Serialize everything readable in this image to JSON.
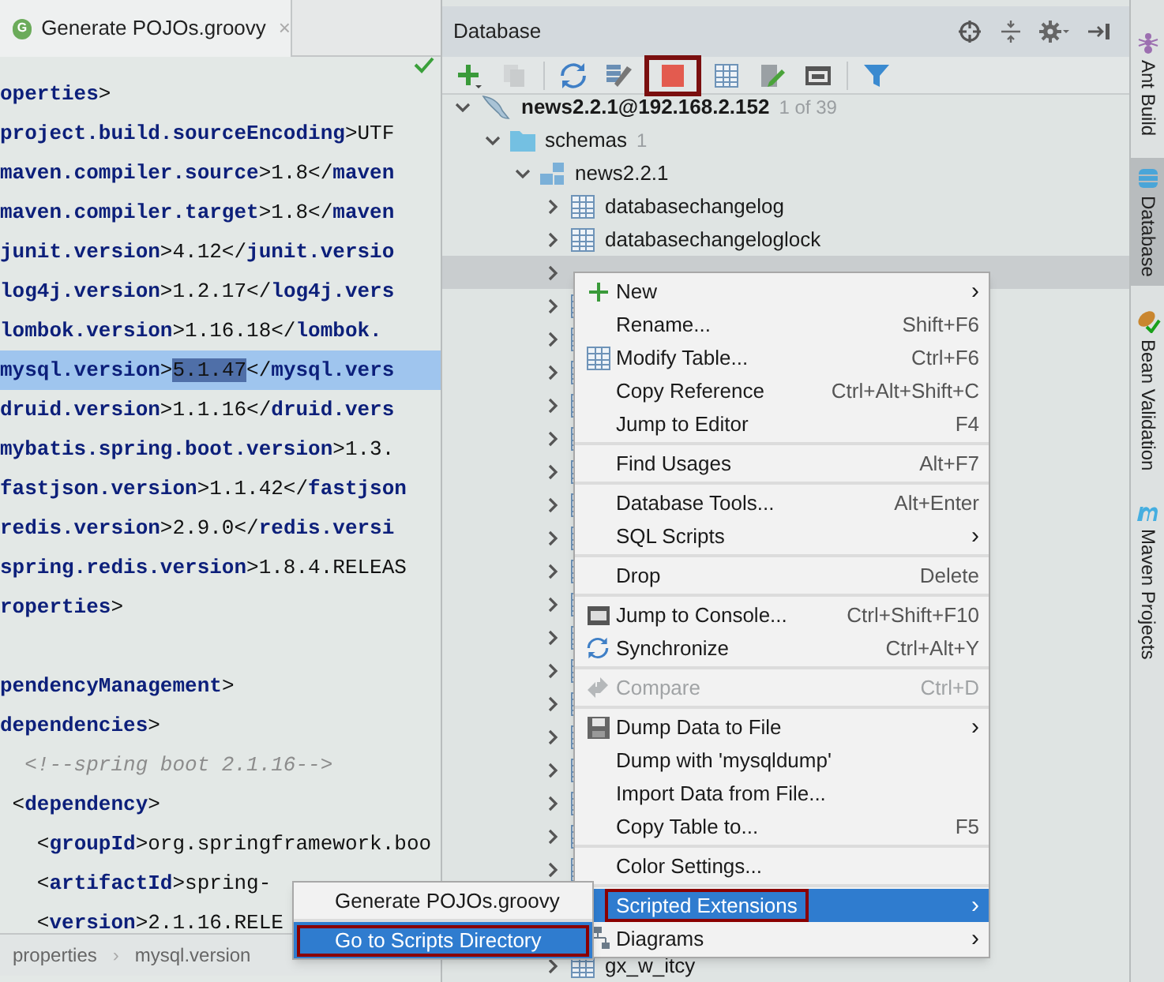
{
  "editor": {
    "tab": {
      "title": "Generate POJOs.groovy",
      "badge": "G",
      "close": "×",
      "selected": true
    },
    "lines": [
      {
        "selected": false,
        "segments": [
          {
            "kind": "tag",
            "text": "operties"
          },
          {
            "kind": "value",
            "text": ">"
          }
        ]
      },
      {
        "selected": false,
        "segments": [
          {
            "kind": "tag",
            "text": "project.build.sourceEncoding"
          },
          {
            "kind": "value",
            "text": ">UTF"
          }
        ]
      },
      {
        "selected": false,
        "segments": [
          {
            "kind": "tag",
            "text": "maven.compiler.source"
          },
          {
            "kind": "value",
            "text": ">1.8</"
          },
          {
            "kind": "tag",
            "text": "maven"
          }
        ]
      },
      {
        "selected": false,
        "segments": [
          {
            "kind": "tag",
            "text": "maven.compiler.target"
          },
          {
            "kind": "value",
            "text": ">1.8</"
          },
          {
            "kind": "tag",
            "text": "maven"
          }
        ]
      },
      {
        "selected": false,
        "segments": [
          {
            "kind": "tag",
            "text": "junit.version"
          },
          {
            "kind": "value",
            "text": ">4.12</"
          },
          {
            "kind": "tag",
            "text": "junit.versio"
          }
        ]
      },
      {
        "selected": false,
        "segments": [
          {
            "kind": "tag",
            "text": "log4j.version"
          },
          {
            "kind": "value",
            "text": ">1.2.17</"
          },
          {
            "kind": "tag",
            "text": "log4j.vers"
          }
        ]
      },
      {
        "selected": false,
        "segments": [
          {
            "kind": "tag",
            "text": "lombok.version"
          },
          {
            "kind": "value",
            "text": ">1.16.18</"
          },
          {
            "kind": "tag",
            "text": "lombok."
          }
        ]
      },
      {
        "selected": true,
        "segments": [
          {
            "kind": "tag",
            "text": "mysql.version"
          },
          {
            "kind": "value",
            "text": ">"
          },
          {
            "kind": "selection",
            "text": "5.1.47"
          },
          {
            "kind": "value",
            "text": "</"
          },
          {
            "kind": "tag",
            "text": "mysql.vers"
          }
        ]
      },
      {
        "selected": false,
        "segments": [
          {
            "kind": "tag",
            "text": "druid.version"
          },
          {
            "kind": "value",
            "text": ">1.1.16</"
          },
          {
            "kind": "tag",
            "text": "druid.vers"
          }
        ]
      },
      {
        "selected": false,
        "segments": [
          {
            "kind": "tag",
            "text": "mybatis.spring.boot.version"
          },
          {
            "kind": "value",
            "text": ">1.3."
          }
        ]
      },
      {
        "selected": false,
        "segments": [
          {
            "kind": "tag",
            "text": "fastjson.version"
          },
          {
            "kind": "value",
            "text": ">1.1.42</"
          },
          {
            "kind": "tag",
            "text": "fastjson"
          }
        ]
      },
      {
        "selected": false,
        "segments": [
          {
            "kind": "tag",
            "text": "redis.version"
          },
          {
            "kind": "value",
            "text": ">2.9.0</"
          },
          {
            "kind": "tag",
            "text": "redis.versi"
          }
        ]
      },
      {
        "selected": false,
        "segments": [
          {
            "kind": "tag",
            "text": "spring.redis.version"
          },
          {
            "kind": "value",
            "text": ">1.8.4.RELEAS"
          }
        ]
      },
      {
        "selected": false,
        "segments": [
          {
            "kind": "tag",
            "text": "roperties"
          },
          {
            "kind": "value",
            "text": ">"
          }
        ]
      },
      {
        "selected": false
      },
      {
        "selected": false,
        "segments": [
          {
            "kind": "tag",
            "text": "pendencyManagement"
          },
          {
            "kind": "value",
            "text": ">"
          }
        ]
      },
      {
        "selected": false,
        "segments": [
          {
            "kind": "tag",
            "text": "dependencies"
          },
          {
            "kind": "value",
            "text": ">"
          }
        ]
      },
      {
        "selected": false,
        "segments": [
          {
            "kind": "comment",
            "text": "  <!--spring boot 2.1.16-->"
          }
        ]
      },
      {
        "selected": false,
        "segments": [
          {
            "kind": "value",
            "text": " <"
          },
          {
            "kind": "tag",
            "text": "dependency"
          },
          {
            "kind": "value",
            "text": ">"
          }
        ]
      },
      {
        "selected": false,
        "segments": [
          {
            "kind": "value",
            "text": "   <"
          },
          {
            "kind": "tag",
            "text": "groupId"
          },
          {
            "kind": "value",
            "text": ">org.springframework.boo"
          }
        ]
      },
      {
        "selected": false,
        "segments": [
          {
            "kind": "value",
            "text": "   <"
          },
          {
            "kind": "tag",
            "text": "artifactId"
          },
          {
            "kind": "value",
            "text": ">spring-"
          }
        ]
      },
      {
        "selected": false,
        "segments": [
          {
            "kind": "value",
            "text": "   <"
          },
          {
            "kind": "tag",
            "text": "version"
          },
          {
            "kind": "value",
            "text": ">2.1.16.RELE"
          }
        ]
      }
    ],
    "breadcrumbs": [
      "properties",
      "mysql.version"
    ],
    "breadcrumb_separator": "›"
  },
  "database": {
    "title": "Database",
    "header_tools": [
      {
        "kind": "target"
      },
      {
        "kind": "collapse"
      },
      {
        "kind": "settings"
      },
      {
        "kind": "hide"
      }
    ],
    "toolbar": [
      {
        "kind": "add",
        "disabled": false,
        "highlighted": false
      },
      {
        "kind": "copy",
        "disabled": true,
        "highlighted": false
      },
      {
        "kind": "separator"
      },
      {
        "kind": "refresh",
        "disabled": false,
        "highlighted": false
      },
      {
        "kind": "tools",
        "disabled": false,
        "highlighted": false
      },
      {
        "kind": "stop",
        "disabled": false,
        "highlighted": true
      },
      {
        "kind": "table",
        "disabled": false,
        "highlighted": false
      },
      {
        "kind": "edit",
        "disabled": false,
        "highlighted": false
      },
      {
        "kind": "console",
        "disabled": false,
        "highlighted": false
      },
      {
        "kind": "separator"
      },
      {
        "kind": "filter",
        "disabled": false,
        "highlighted": false
      }
    ],
    "tree": [
      {
        "kind": "connection",
        "name": "news2.2.1@192.168.2.152",
        "count": "1 of 39",
        "expanded": true,
        "selected": false,
        "children": [
          {
            "kind": "folder",
            "name": "schemas",
            "count": "1",
            "expanded": true,
            "selected": false,
            "children": [
              {
                "kind": "schema",
                "name": "news2.2.1",
                "expanded": true,
                "selected": false,
                "children": [
                  {
                    "kind": "table",
                    "name": "databasechangelog",
                    "expanded": false,
                    "selected": false
                  },
                  {
                    "kind": "table",
                    "name": "databasechangeloglock",
                    "expanded": false,
                    "selected": false
                  },
                  {
                    "expanded": false,
                    "selected": true
                  },
                  {
                    "kind": "table",
                    "expanded": false,
                    "selected": false
                  },
                  {
                    "kind": "table",
                    "expanded": false,
                    "selected": false
                  },
                  {
                    "kind": "table",
                    "expanded": false,
                    "selected": false
                  },
                  {
                    "kind": "table",
                    "expanded": false,
                    "selected": false
                  },
                  {
                    "kind": "table",
                    "expanded": false,
                    "selected": false
                  },
                  {
                    "kind": "table",
                    "expanded": false,
                    "selected": false
                  },
                  {
                    "kind": "table",
                    "expanded": false,
                    "selected": false
                  },
                  {
                    "kind": "table",
                    "expanded": false,
                    "selected": false
                  },
                  {
                    "kind": "table",
                    "expanded": false,
                    "selected": false
                  },
                  {
                    "kind": "table",
                    "expanded": false,
                    "selected": false
                  },
                  {
                    "kind": "table",
                    "expanded": false,
                    "selected": false
                  },
                  {
                    "kind": "table",
                    "expanded": false,
                    "selected": false
                  },
                  {
                    "kind": "table",
                    "expanded": false,
                    "selected": false
                  },
                  {
                    "kind": "table",
                    "expanded": false,
                    "selected": false
                  },
                  {
                    "kind": "table",
                    "expanded": false,
                    "selected": false
                  },
                  {
                    "kind": "table",
                    "expanded": false,
                    "selected": false
                  },
                  {
                    "kind": "table",
                    "expanded": false,
                    "selected": false
                  },
                  {
                    "kind": "table",
                    "expanded": false,
                    "selected": false
                  },
                  {
                    "kind": "table",
                    "name": "gx_w_itcy",
                    "expanded": false,
                    "selected": false
                  }
                ]
              }
            ]
          }
        ]
      }
    ]
  },
  "context_menu": {
    "groups": [
      [
        {
          "kind": "create",
          "label": "New",
          "submenu": true,
          "disabled": false,
          "selected": false,
          "highlighted": false
        },
        {
          "kind": "plain",
          "label": "Rename...",
          "shortcut": "Shift+F6",
          "submenu": false,
          "disabled": false,
          "selected": false,
          "highlighted": false
        },
        {
          "kind": "table",
          "label": "Modify Table...",
          "shortcut": "Ctrl+F6",
          "submenu": false,
          "disabled": false,
          "selected": false,
          "highlighted": false
        },
        {
          "kind": "plain",
          "label": "Copy Reference",
          "shortcut": "Ctrl+Alt+Shift+C",
          "submenu": false,
          "disabled": false,
          "selected": false,
          "highlighted": false
        },
        {
          "kind": "plain",
          "label": "Jump to Editor",
          "shortcut": "F4",
          "submenu": false,
          "disabled": false,
          "selected": false,
          "highlighted": false
        }
      ],
      [
        {
          "kind": "plain",
          "label": "Find Usages",
          "shortcut": "Alt+F7",
          "submenu": false,
          "disabled": false,
          "selected": false,
          "highlighted": false
        }
      ],
      [
        {
          "kind": "plain",
          "label": "Database Tools...",
          "shortcut": "Alt+Enter",
          "submenu": false,
          "disabled": false,
          "selected": false,
          "highlighted": false
        },
        {
          "kind": "plain",
          "label": "SQL Scripts",
          "submenu": true,
          "disabled": false,
          "selected": false,
          "highlighted": false
        }
      ],
      [
        {
          "kind": "plain",
          "label": "Drop",
          "shortcut": "Delete",
          "submenu": false,
          "disabled": false,
          "selected": false,
          "highlighted": false
        }
      ],
      [
        {
          "kind": "console",
          "label": "Jump to Console...",
          "shortcut": "Ctrl+Shift+F10",
          "submenu": false,
          "disabled": false,
          "selected": false,
          "highlighted": false
        },
        {
          "kind": "sync",
          "label": "Synchronize",
          "shortcut": "Ctrl+Alt+Y",
          "submenu": false,
          "disabled": false,
          "selected": false,
          "highlighted": false
        }
      ],
      [
        {
          "kind": "compare",
          "label": "Compare",
          "shortcut": "Ctrl+D",
          "submenu": false,
          "disabled": true,
          "selected": false,
          "highlighted": false
        }
      ],
      [
        {
          "kind": "dump",
          "label": "Dump Data to File",
          "submenu": true,
          "disabled": false,
          "selected": false,
          "highlighted": false
        },
        {
          "kind": "plain",
          "label": "Dump with 'mysqldump'",
          "submenu": false,
          "disabled": false,
          "selected": false,
          "highlighted": false
        },
        {
          "kind": "plain",
          "label": "Import Data from File...",
          "submenu": false,
          "disabled": false,
          "selected": false,
          "highlighted": false
        },
        {
          "kind": "plain",
          "label": "Copy Table to...",
          "shortcut": "F5",
          "submenu": false,
          "disabled": false,
          "selected": false,
          "highlighted": false
        }
      ],
      [
        {
          "kind": "plain",
          "label": "Color Settings...",
          "submenu": false,
          "disabled": false,
          "selected": false,
          "highlighted": false
        }
      ],
      [
        {
          "kind": "plain",
          "label": "Scripted Extensions",
          "submenu": true,
          "disabled": false,
          "selected": true,
          "highlighted": true
        },
        {
          "kind": "diagram",
          "label": "Diagrams",
          "submenu": true,
          "disabled": false,
          "selected": false,
          "highlighted": false
        }
      ]
    ],
    "submenu_arrow": "›"
  },
  "submenu": {
    "groups": [
      [
        {
          "label": "Generate POJOs.groovy",
          "selected": false,
          "highlighted": false
        }
      ],
      [
        {
          "label": "Go to Scripts Directory",
          "selected": true,
          "highlighted": true
        }
      ]
    ]
  },
  "side_tabs": [
    {
      "kind": "ant",
      "label": "Ant Build",
      "selected": false
    },
    {
      "kind": "database",
      "label": "Database",
      "selected": true
    },
    {
      "kind": "bean",
      "label": "Bean Validation",
      "selected": false
    },
    {
      "kind": "maven",
      "label": "Maven Projects",
      "selected": false
    }
  ]
}
